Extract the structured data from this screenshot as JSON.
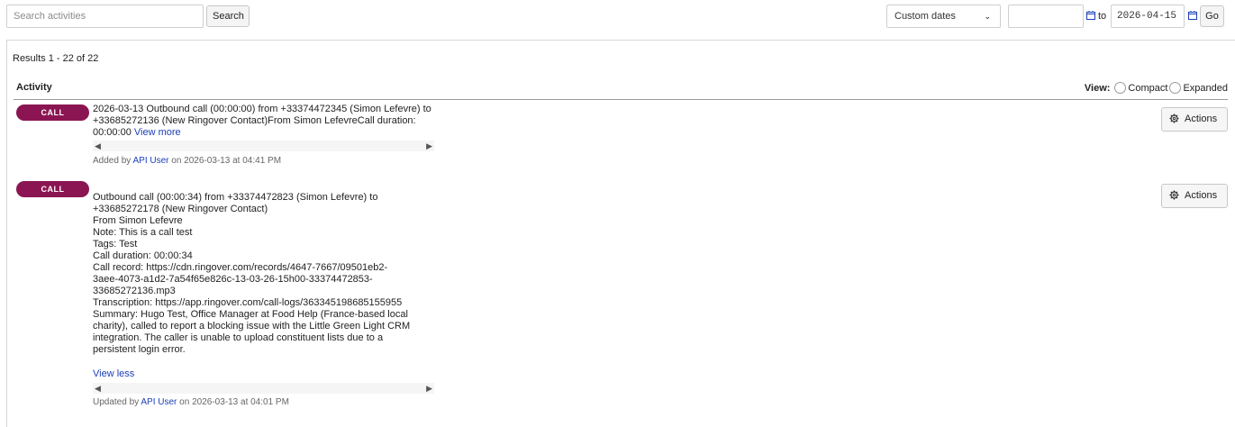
{
  "toolbar": {
    "search_placeholder": "Search activities",
    "search_label": "Search",
    "date_range_option": "Custom dates",
    "date_from": "",
    "to_label": "to",
    "date_to": "2026-04-15",
    "go_label": "Go"
  },
  "results": {
    "summary": "Results 1 - 22 of 22",
    "column_header": "Activity",
    "view_label": "View:",
    "view_compact": "Compact",
    "view_expanded": "Expanded"
  },
  "entries": [
    {
      "type": "CALL",
      "text": "2026-03-13 Outbound call (00:00:00) from +33374472345 (Simon Lefevre) to +33685272136 (New Ringover Contact)From Simon LefevreCall duration: 00:00:00 ",
      "toggle": "View more",
      "meta_prefix": "Added by ",
      "meta_user": "API User",
      "meta_suffix": " on 2026-03-13 at 04:41 PM",
      "actions": "Actions"
    },
    {
      "type": "CALL",
      "text": "Outbound call (00:00:34) from +33374472823 (Simon Lefevre) to\n+33685272178 (New Ringover Contact)\nFrom Simon Lefevre\nNote: This is a call test\nTags: Test\nCall duration: 00:00:34\nCall record: https://cdn.ringover.com/records/4647-7667/09501eb2-\n3aee-4073-a1d2-7a54f65e826c-13-03-26-15h00-33374472853-\n33685272136.mp3\nTranscription: https://app.ringover.com/call-logs/363345198685155955\nSummary: Hugo Test, Office Manager at Food Help (France-based local\ncharity), called to report a blocking issue with the Little Green Light CRM\nintegration. The caller is unable to upload constituent lists due to a\npersistent login error.",
      "toggle": "View less",
      "meta_prefix": "Updated by ",
      "meta_user": "API User",
      "meta_suffix": " on 2026-03-13 at 04:01 PM",
      "actions": "Actions"
    }
  ],
  "icons": {
    "calendar": "calendar-icon",
    "gear": "gear-icon",
    "chevron": "chevron-down-icon"
  },
  "colors": {
    "badge": "#8b1552",
    "link": "#1a3fb8"
  }
}
